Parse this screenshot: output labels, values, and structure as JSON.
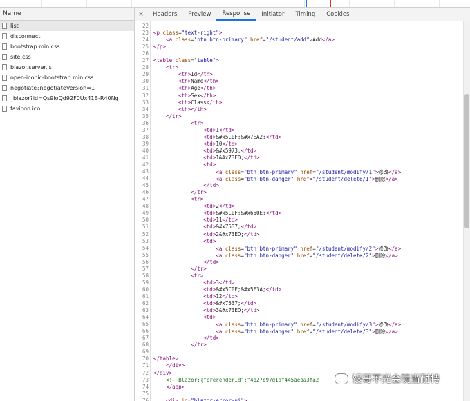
{
  "network": {
    "name_header": "Name",
    "requests": [
      {
        "name": "list",
        "selected": true
      },
      {
        "name": "disconnect",
        "selected": false
      },
      {
        "name": "bootstrap.min.css",
        "selected": false
      },
      {
        "name": "site.css",
        "selected": false
      },
      {
        "name": "blazor.server.js",
        "selected": false
      },
      {
        "name": "open-iconic-bootstrap.min.css",
        "selected": false
      },
      {
        "name": "negotiate?negotiateVersion=1",
        "selected": false
      },
      {
        "name": "_blazor?id=Qs9ioQd92F0Ux41B-R40Ng",
        "selected": false
      },
      {
        "name": "favicon.ico",
        "selected": false
      }
    ]
  },
  "tabs": {
    "close_icon": "×",
    "items": [
      {
        "label": "Headers",
        "active": false
      },
      {
        "label": "Preview",
        "active": false
      },
      {
        "label": "Response",
        "active": true
      },
      {
        "label": "Initiator",
        "active": false
      },
      {
        "label": "Timing",
        "active": false
      },
      {
        "label": "Cookies",
        "active": false
      }
    ]
  },
  "response": {
    "lines": [
      {
        "n": "22",
        "text": ""
      },
      {
        "n": "23",
        "text": "<p class=\"text-right\">"
      },
      {
        "n": "24",
        "text": "    <a class=\"btn btn-primary\" href=\"/student/add\">Add</a>"
      },
      {
        "n": "25",
        "text": "</p>"
      },
      {
        "n": "26",
        "text": ""
      },
      {
        "n": "27",
        "text": "<table class=\"table\">"
      },
      {
        "n": "28",
        "text": "    <tr>"
      },
      {
        "n": "29",
        "text": "        <th>Id</th>"
      },
      {
        "n": "30",
        "text": "        <th>Name</th>"
      },
      {
        "n": "31",
        "text": "        <th>Age</th>"
      },
      {
        "n": "32",
        "text": "        <th>Sex</th>"
      },
      {
        "n": "33",
        "text": "        <th>Class</th>"
      },
      {
        "n": "34",
        "text": "        <th></th>"
      },
      {
        "n": "35",
        "text": "    </tr>"
      },
      {
        "n": "36",
        "text": "            <tr>"
      },
      {
        "n": "37",
        "text": "                <td>1</td>"
      },
      {
        "n": "38",
        "text": "                <td>&#x5C0F;&#x7EA2;</td>"
      },
      {
        "n": "39",
        "text": "                <td>10</td>"
      },
      {
        "n": "40",
        "text": "                <td>&#x5973;</td>"
      },
      {
        "n": "41",
        "text": "                <td>1&#x73ED;</td>"
      },
      {
        "n": "42",
        "text": "                <td>"
      },
      {
        "n": "43",
        "text": "                    <a class=\"btn btn-primary\" href=\"/student/modify/1\">修改</a>"
      },
      {
        "n": "44",
        "text": "                    <a class=\"btn btn-danger\" href=\"/student/delete/1\">删除</a>"
      },
      {
        "n": "45",
        "text": "                </td>"
      },
      {
        "n": "46",
        "text": "            </tr>"
      },
      {
        "n": "47",
        "text": "            <tr>"
      },
      {
        "n": "48",
        "text": "                <td>2</td>"
      },
      {
        "n": "49",
        "text": "                <td>&#x5C0F;&#x660E;</td>"
      },
      {
        "n": "50",
        "text": "                <td>11</td>"
      },
      {
        "n": "51",
        "text": "                <td>&#x7537;</td>"
      },
      {
        "n": "52",
        "text": "                <td>2&#x73ED;</td>"
      },
      {
        "n": "53",
        "text": "                <td>"
      },
      {
        "n": "54",
        "text": "                    <a class=\"btn btn-primary\" href=\"/student/modify/2\">修改</a>"
      },
      {
        "n": "55",
        "text": "                    <a class=\"btn btn-danger\" href=\"/student/delete/2\">删除</a>"
      },
      {
        "n": "56",
        "text": "                </td>"
      },
      {
        "n": "57",
        "text": "            </tr>"
      },
      {
        "n": "58",
        "text": "            <tr>"
      },
      {
        "n": "59",
        "text": "                <td>3</td>"
      },
      {
        "n": "60",
        "text": "                <td>&#x5C0F;&#x5F3A;</td>"
      },
      {
        "n": "61",
        "text": "                <td>12</td>"
      },
      {
        "n": "62",
        "text": "                <td>&#x7537;</td>"
      },
      {
        "n": "63",
        "text": "                <td>3&#x73ED;</td>"
      },
      {
        "n": "64",
        "text": "                <td>"
      },
      {
        "n": "65",
        "text": "                    <a class=\"btn btn-primary\" href=\"/student/modify/3\">修改</a>"
      },
      {
        "n": "66",
        "text": "                    <a class=\"btn btn-danger\" href=\"/student/delete/3\">删除</a>"
      },
      {
        "n": "67",
        "text": "                </td>"
      },
      {
        "n": "68",
        "text": "            </tr>"
      },
      {
        "n": "69",
        "text": ""
      },
      {
        "n": "70",
        "text": "</table>"
      },
      {
        "n": "71",
        "text": "    </div>"
      },
      {
        "n": "72",
        "text": "</div>"
      },
      {
        "n": "73",
        "text": "    <!--Blazor:{\"prerenderId\":\"4b27e97d1af445aeba3fa2"
      },
      {
        "n": "74",
        "text": "    </app>"
      },
      {
        "n": "75",
        "text": ""
      },
      {
        "n": "76",
        "text": "    <div id=\"blazor-error-ui\">"
      }
    ]
  },
  "watermark": {
    "text": "馒哥不光会玩当耐特",
    "icon": "wechat-icon"
  },
  "colors": {
    "tag": "#881280",
    "attribute": "#994500",
    "value": "#1a1aa6",
    "comment": "#236e25",
    "active_tab_underline": "#1a73e8"
  }
}
